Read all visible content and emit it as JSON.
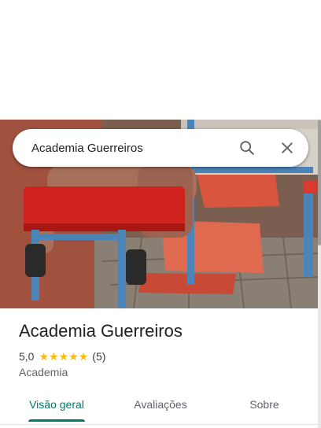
{
  "search": {
    "value": "Academia Guerreiros",
    "search_icon": "search-icon",
    "close_icon": "close-icon"
  },
  "photo": {
    "description_icon": "place-photo"
  },
  "place": {
    "title": "Academia Guerreiros",
    "rating": "5,0",
    "stars": 5,
    "review_count": "(5)",
    "category": "Academia"
  },
  "tabs": [
    {
      "label": "Visão geral",
      "active": true
    },
    {
      "label": "Avaliações",
      "active": false
    },
    {
      "label": "Sobre",
      "active": false
    }
  ],
  "colors": {
    "accent": "#00796b",
    "star": "#fbbc04"
  }
}
